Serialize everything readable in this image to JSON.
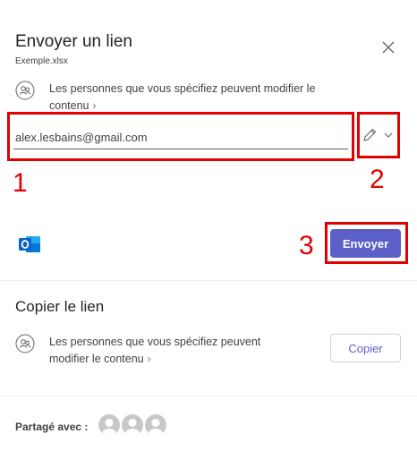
{
  "dialog": {
    "title": "Envoyer un lien",
    "file_name": "Exemple.xlsx",
    "close_icon": "close-icon"
  },
  "send_section": {
    "permission_text": "Les personnes que vous spécifiez peuvent modifier le contenu",
    "permission_icon": "people-icon",
    "email_value": "alex.lesbains@gmail.com",
    "edit_icon": "pencil-icon",
    "dropdown_icon": "chevron-down-icon",
    "app_icon": "outlook-icon",
    "send_label": "Envoyer"
  },
  "annotations": {
    "label_1": "1",
    "label_2": "2",
    "label_3": "3",
    "color": "#e30000"
  },
  "copy_section": {
    "title": "Copier le lien",
    "permission_text": "Les personnes que vous spécifiez peuvent modifier le contenu",
    "copy_label": "Copier"
  },
  "shared": {
    "label": "Partagé avec :",
    "avatar_count": 3
  },
  "colors": {
    "accent": "#5b5fc7",
    "outlook_blue": "#0a64c8"
  }
}
